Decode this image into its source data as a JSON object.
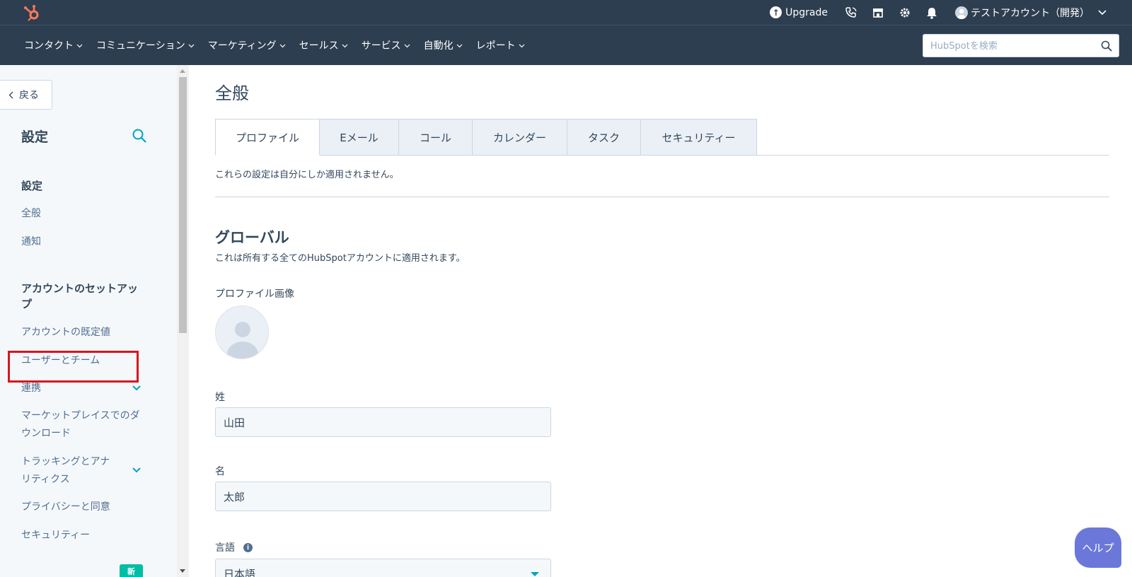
{
  "topbar": {
    "upgrade_label": "Upgrade",
    "account_label": "テストアカウント（開発）"
  },
  "nav": {
    "items": [
      {
        "label": "コンタクト"
      },
      {
        "label": "コミュニケーション"
      },
      {
        "label": "マーケティング"
      },
      {
        "label": "セールス"
      },
      {
        "label": "サービス"
      },
      {
        "label": "自動化"
      },
      {
        "label": "レポート"
      }
    ],
    "search_placeholder": "HubSpotを検索"
  },
  "sidebar": {
    "back_label": "戻る",
    "title": "設定",
    "section_settings": "設定",
    "link_general": "全般",
    "link_notifications": "通知",
    "section_account_setup": "アカウントのセットアップ",
    "link_account_defaults": "アカウントの既定値",
    "link_users_teams": "ユーザーとチーム",
    "link_integrations": "連携",
    "link_marketplace_downloads": "マーケットプレイスでのダウンロード",
    "link_tracking_analytics": "トラッキングとアナリティクス",
    "link_privacy_consent": "プライバシーと同意",
    "link_security": "セキュリティー",
    "new_badge": "新"
  },
  "main": {
    "page_title": "全般",
    "tabs": [
      {
        "label": "プロファイル",
        "active": true
      },
      {
        "label": "Eメール",
        "active": false
      },
      {
        "label": "コール",
        "active": false
      },
      {
        "label": "カレンダー",
        "active": false
      },
      {
        "label": "タスク",
        "active": false
      },
      {
        "label": "セキュリティー",
        "active": false
      }
    ],
    "tab_description": "これらの設定は自分にしか適用されません。",
    "global_title": "グローバル",
    "global_description": "これは所有する全てのHubSpotアカウントに適用されます。",
    "profile_image_label": "プロファイル画像",
    "last_name_label": "姓",
    "last_name_value": "山田",
    "first_name_label": "名",
    "first_name_value": "太郎",
    "language_label": "言語",
    "language_value": "日本語"
  },
  "help_label": "ヘルプ",
  "colors": {
    "nav_bg": "#2d3e50",
    "accent": "#00a4bd",
    "highlight": "#d9151f",
    "help_bg": "#6b78d9",
    "badge": "#00bda5"
  }
}
